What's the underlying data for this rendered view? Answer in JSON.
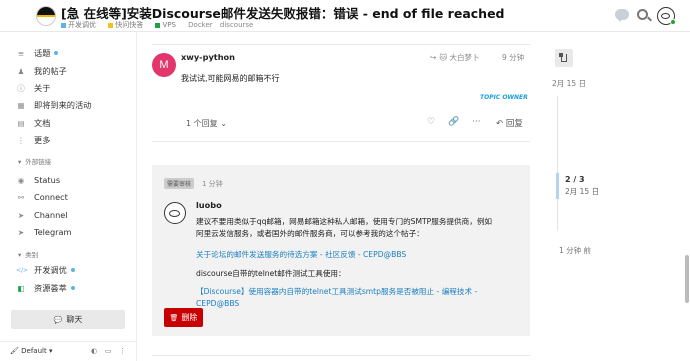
{
  "header": {
    "title": "[急 在线等]安装Discourse邮件发送失败报错：错误 - end of file reached",
    "crumbs": [
      {
        "label": "开发调优",
        "color": "#5fb2e8"
      },
      {
        "label": "快问快答",
        "color": "#f0c419"
      },
      {
        "label": "VPS",
        "color": "#1aa34a"
      }
    ],
    "tags": [
      "Docker",
      "discourse"
    ]
  },
  "sidebar": {
    "items": [
      {
        "label": "话题",
        "icon": "layers-icon",
        "glyph": "≡",
        "dot": true
      },
      {
        "label": "我的帖子",
        "icon": "user-icon",
        "glyph": "♟",
        "dot": false
      },
      {
        "label": "关于",
        "icon": "info-icon",
        "glyph": "ⓘ",
        "dot": false
      },
      {
        "label": "即将到来的活动",
        "icon": "calendar-icon",
        "glyph": "▦",
        "dot": false
      },
      {
        "label": "文档",
        "icon": "book-icon",
        "glyph": "▤",
        "dot": false
      },
      {
        "label": "更多",
        "icon": "more-icon",
        "glyph": "⋮",
        "dot": false
      }
    ],
    "section_links": "外部链接",
    "links": [
      {
        "label": "Status",
        "icon": "status-icon",
        "glyph": "◉"
      },
      {
        "label": "Connect",
        "icon": "link-icon",
        "glyph": "⚯"
      },
      {
        "label": "Channel",
        "icon": "send-icon",
        "glyph": "➤"
      },
      {
        "label": "Telegram",
        "icon": "telegram-icon",
        "glyph": "➤"
      }
    ],
    "section_categories": "类别",
    "categories": [
      {
        "label": "开发调优",
        "icon": "code-icon",
        "glyph": "</>",
        "color": "#5fb2e8",
        "dot": true
      },
      {
        "label": "资源荟萃",
        "icon": "resource-icon",
        "glyph": "◧",
        "color": "#1aa34a",
        "dot": true
      }
    ],
    "chat_label": "聊天",
    "theme_label": "Default"
  },
  "post1": {
    "avatar_letter": "M",
    "username": "xwy-python",
    "reply_to": "大白梦卜",
    "time": "9 分钟",
    "body": "我试试,可能网易的邮箱不行",
    "badge": "TOPIC OWNER",
    "replies": "1 个回复",
    "reply_label": "回复"
  },
  "post2": {
    "staff_badge": "需要审核",
    "time": "1 分钟",
    "username": "luobo",
    "para1": "建议不要用类似于qq邮箱，网易邮箱这种私人邮箱，使用专门的SMTP服务提供商，例如阿里云发信服务，或者国外的邮件服务商，可以参考我的这个帖子：",
    "link1": "关于论坛的邮件发送服务的待选方案 - 社区反馈 - CEPD@BBS",
    "para2": "discourse自带的telnet邮件测试工具使用：",
    "link2": "【Discourse】使用容器内自带的telnet工具测试smtp服务是否被阻止 - 编程技术 - CEPD@BBS",
    "delete_label": "删除"
  },
  "timeline": {
    "top_date": "2月 15 日",
    "position": "2 / 3",
    "date": "2月 15 日",
    "ago": "1 分钟 前"
  }
}
